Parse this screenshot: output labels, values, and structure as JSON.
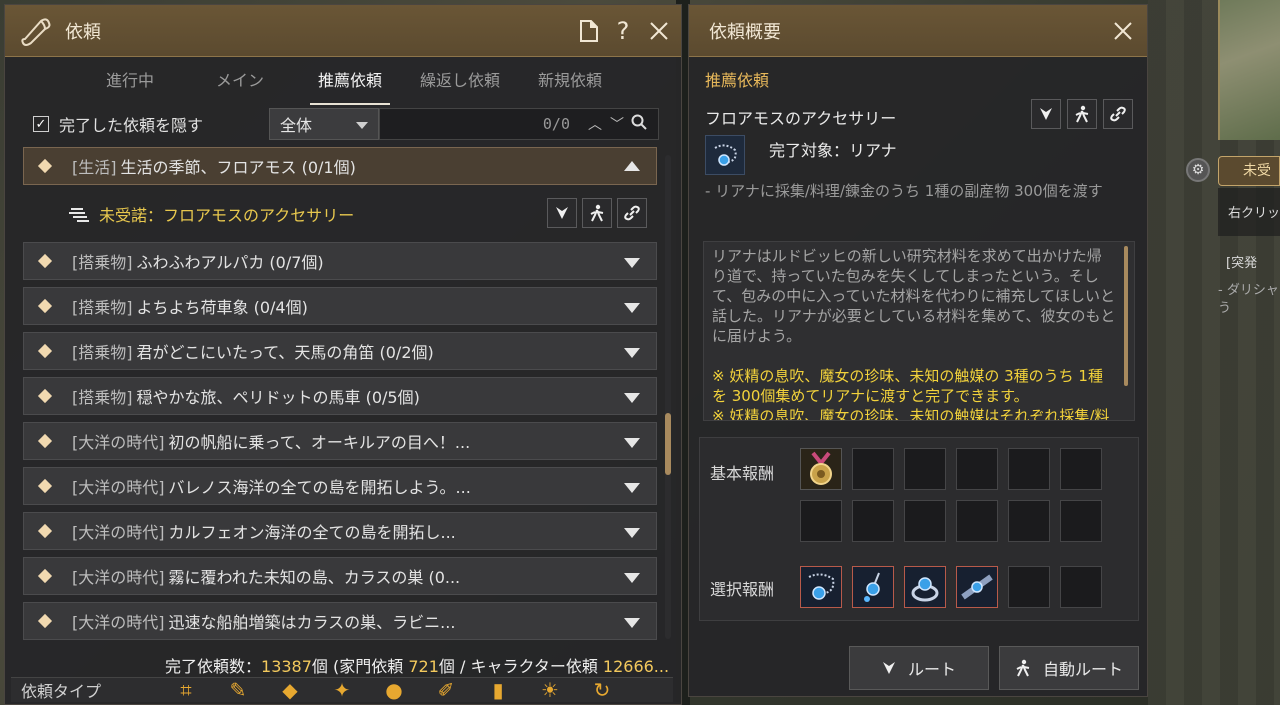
{
  "quest_window": {
    "title": "依頼",
    "help_label": "?",
    "tabs": [
      {
        "label": "進行中"
      },
      {
        "label": "メイン"
      },
      {
        "label": "推薦依頼",
        "active": true
      },
      {
        "label": "繰返し依頼"
      },
      {
        "label": "新規依頼"
      }
    ],
    "hide_completed_label": "完了した依頼を隠す",
    "filter_value": "全体",
    "search_count": "0/0",
    "expanded_quest": {
      "category": "[生活]",
      "name": "生活の季節、フロアモス (0/1個)"
    },
    "sub_quest": {
      "prefix": "未受諾：フロアモスのアクセサリー"
    },
    "quests": [
      {
        "category": "[搭乗物]",
        "name": "ふわふわアルパカ (0/7個)"
      },
      {
        "category": "[搭乗物]",
        "name": "よちよち荷車象 (0/4個)"
      },
      {
        "category": "[搭乗物]",
        "name": "君がどこにいたって、天馬の角笛 (0/2個)"
      },
      {
        "category": "[搭乗物]",
        "name": "穏やかな旅、ペリドットの馬車 (0/5個)"
      },
      {
        "category": "[大洋の時代]",
        "name": "初の帆船に乗って、オーキルアの目へ！..."
      },
      {
        "category": "[大洋の時代]",
        "name": "バレノス海洋の全ての島を開拓しよう。..."
      },
      {
        "category": "[大洋の時代]",
        "name": "カルフェオン海洋の全ての島を開拓し..."
      },
      {
        "category": "[大洋の時代]",
        "name": "霧に覆われた未知の島、カラスの巣 (0..."
      },
      {
        "category": "[大洋の時代]",
        "name": "迅速な船舶増築はカラスの巣、ラビニ..."
      }
    ],
    "completed": {
      "label": "完了依頼数：",
      "total": "13387",
      "unit": "個 (家門依頼 ",
      "family": "721",
      "mid": "個 / キャラクター依頼 ",
      "character": "12666..."
    },
    "type_label": "依頼タイプ"
  },
  "detail_window": {
    "title": "依頼概要",
    "section": "推薦依頼",
    "quest_name": "フロアモスのアクセサリー",
    "target": "完了対象：リアナ",
    "goal": "- リアナに採集/料理/錬金のうち 1種の副産物 300個を渡す",
    "description": "リアナはルドビッヒの新しい研究材料を求めて出かけた帰り道で、持っていた包みを失くしてしまったという。そして、包みの中に入っていた材料を代わりに補充してほしいと話した。リアナが必要としている材料を集めて、彼女のもとに届けよう。",
    "note1": "※ 妖精の息吹、魔女の珍味、未知の触媒の 3種のうち 1種を 300個集めてリアナに渡すと完了できます。",
    "note2": "※ 妖精の息吹、魔女の珍味、未知の触媒はそれぞれ採集/料理/錬金を行った際に既定の確率で獲得できます。",
    "basic_reward_label": "基本報酬",
    "select_reward_label": "選択報酬",
    "route_button": "ルート",
    "auto_route_button": "自動ルート"
  },
  "hud": {
    "tag": "未受",
    "hint": "右クリック",
    "event": "[突発",
    "event_desc": "- ダリシャう"
  },
  "colors": {
    "accent": "#e6b75a",
    "header": "#5b4a2f",
    "highlight": "#f2d23b"
  }
}
